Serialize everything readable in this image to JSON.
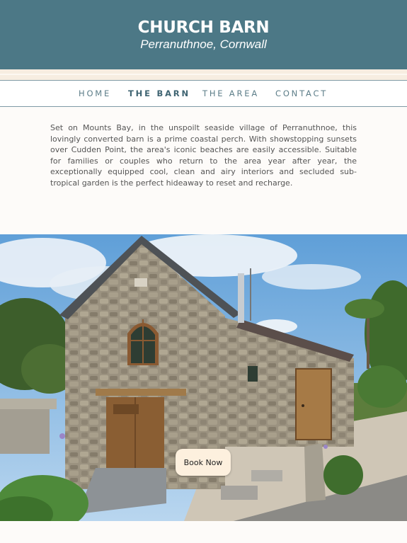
{
  "header": {
    "title": "CHURCH BARN",
    "subtitle": "Perranuthnoe, Cornwall"
  },
  "nav": {
    "items": [
      "HOME",
      "THE BARN",
      "THE AREA",
      "CONTACT"
    ],
    "active": "THE BARN"
  },
  "intro": {
    "text": "Set on Mounts Bay, in the unspoilt seaside village of Perranuthnoe, this lovingly converted barn is a prime coastal perch. With showstopping sunsets over Cudden Point, the area's iconic beaches are easily accessible. Suitable for families or couples who return to the area year after year, the exceptionally equipped cool, clean and airy interiors and secluded sub-tropical garden is the perfect hideaway to reset and recharge."
  },
  "cta": {
    "book_label": "Book Now"
  },
  "colors": {
    "header_bg": "#4c7886",
    "nav_text": "#5d7e89",
    "button_bg": "#fdf0de"
  }
}
